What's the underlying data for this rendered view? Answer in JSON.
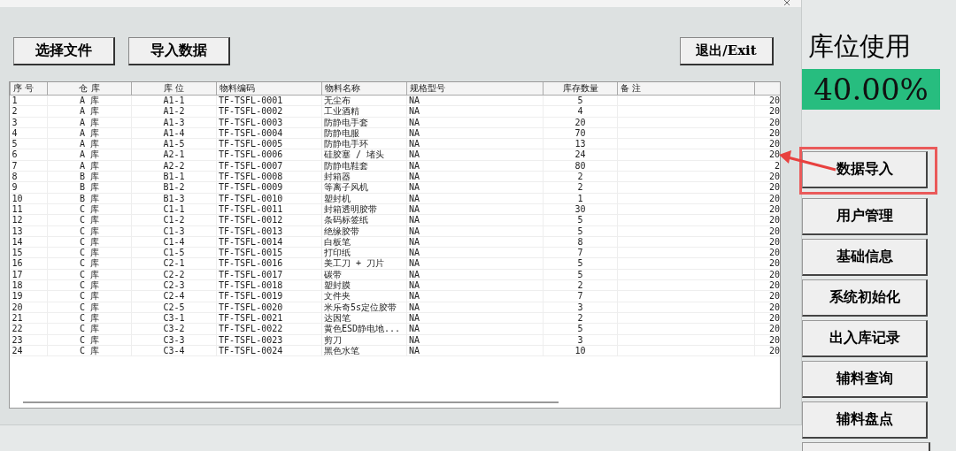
{
  "toolbar": {
    "buttons": [
      "选择文件",
      "导入数据"
    ],
    "exit_button": "退出/Exit"
  },
  "table": {
    "columns": [
      "序 号",
      "仓 库",
      "库 位",
      "物料编码",
      "物料名称",
      "规格型号",
      "库存数量",
      "备 注"
    ],
    "rows": [
      [
        "1",
        "A 库",
        "A1-1",
        "TF-TSFL-0001",
        "无尘布",
        "NA",
        "5",
        "",
        "20"
      ],
      [
        "2",
        "A 库",
        "A1-2",
        "TF-TSFL-0002",
        "工业酒精",
        "NA",
        "4",
        "",
        "20"
      ],
      [
        "3",
        "A 库",
        "A1-3",
        "TF-TSFL-0003",
        "防静电手套",
        "NA",
        "20",
        "",
        "20"
      ],
      [
        "4",
        "A 库",
        "A1-4",
        "TF-TSFL-0004",
        "防静电服",
        "NA",
        "70",
        "",
        "20"
      ],
      [
        "5",
        "A 库",
        "A1-5",
        "TF-TSFL-0005",
        "防静电手环",
        "NA",
        "13",
        "",
        "20"
      ],
      [
        "6",
        "A 库",
        "A2-1",
        "TF-TSFL-0006",
        "硅胶塞 / 堵头",
        "NA",
        "24",
        "",
        "20"
      ],
      [
        "7",
        "A 库",
        "A2-2",
        "TF-TSFL-0007",
        "防静电鞋套",
        "NA",
        "80",
        "",
        "2"
      ],
      [
        "8",
        "B 库",
        "B1-1",
        "TF-TSFL-0008",
        "封箱器",
        "NA",
        "2",
        "",
        "20"
      ],
      [
        "9",
        "B 库",
        "B1-2",
        "TF-TSFL-0009",
        "等离子风机",
        "NA",
        "2",
        "",
        "20"
      ],
      [
        "10",
        "B 库",
        "B1-3",
        "TF-TSFL-0010",
        "塑封机",
        "NA",
        "1",
        "",
        "20"
      ],
      [
        "11",
        "C 库",
        "C1-1",
        "TF-TSFL-0011",
        "封箱透明胶带",
        "NA",
        "30",
        "",
        "20"
      ],
      [
        "12",
        "C 库",
        "C1-2",
        "TF-TSFL-0012",
        "条码标签纸",
        "NA",
        "5",
        "",
        "20"
      ],
      [
        "13",
        "C 库",
        "C1-3",
        "TF-TSFL-0013",
        "绝缘胶带",
        "NA",
        "5",
        "",
        "20"
      ],
      [
        "14",
        "C 库",
        "C1-4",
        "TF-TSFL-0014",
        "白板笔",
        "NA",
        "8",
        "",
        "20"
      ],
      [
        "15",
        "C 库",
        "C1-5",
        "TF-TSFL-0015",
        "打印纸",
        "NA",
        "7",
        "",
        "20"
      ],
      [
        "16",
        "C 库",
        "C2-1",
        "TF-TSFL-0016",
        "美工刀 + 刀片",
        "NA",
        "5",
        "",
        "20"
      ],
      [
        "17",
        "C 库",
        "C2-2",
        "TF-TSFL-0017",
        "碳带",
        "NA",
        "5",
        "",
        "20"
      ],
      [
        "18",
        "C 库",
        "C2-3",
        "TF-TSFL-0018",
        "塑封膜",
        "NA",
        "2",
        "",
        "20"
      ],
      [
        "19",
        "C 库",
        "C2-4",
        "TF-TSFL-0019",
        "文件夹",
        "NA",
        "7",
        "",
        "20"
      ],
      [
        "20",
        "C 库",
        "C2-5",
        "TF-TSFL-0020",
        "米乐奇5s定位胶带",
        "NA",
        "3",
        "",
        "20"
      ],
      [
        "21",
        "C 库",
        "C3-1",
        "TF-TSFL-0021",
        "达因笔",
        "NA",
        "2",
        "",
        "20"
      ],
      [
        "22",
        "C 库",
        "C3-2",
        "TF-TSFL-0022",
        "黄色ESD静电地...",
        "NA",
        "5",
        "",
        "20"
      ],
      [
        "23",
        "C 库",
        "C3-3",
        "TF-TSFL-0023",
        "剪刀",
        "NA",
        "3",
        "",
        "20"
      ],
      [
        "24",
        "C 库",
        "C3-4",
        "TF-TSFL-0024",
        "黑色水笔",
        "NA",
        "10",
        "",
        "20"
      ]
    ]
  },
  "usage": {
    "label": "库位使用",
    "value": "40.00%"
  },
  "nav": [
    {
      "label": "数据导入",
      "highlighted": true
    },
    {
      "label": "用户管理",
      "highlighted": false
    },
    {
      "label": "基础信息",
      "highlighted": false
    },
    {
      "label": "系统初始化",
      "highlighted": false
    },
    {
      "label": "出入库记录",
      "highlighted": false
    },
    {
      "label": "辅料查询",
      "highlighted": false
    },
    {
      "label": "辅料盘点",
      "highlighted": false
    }
  ]
}
